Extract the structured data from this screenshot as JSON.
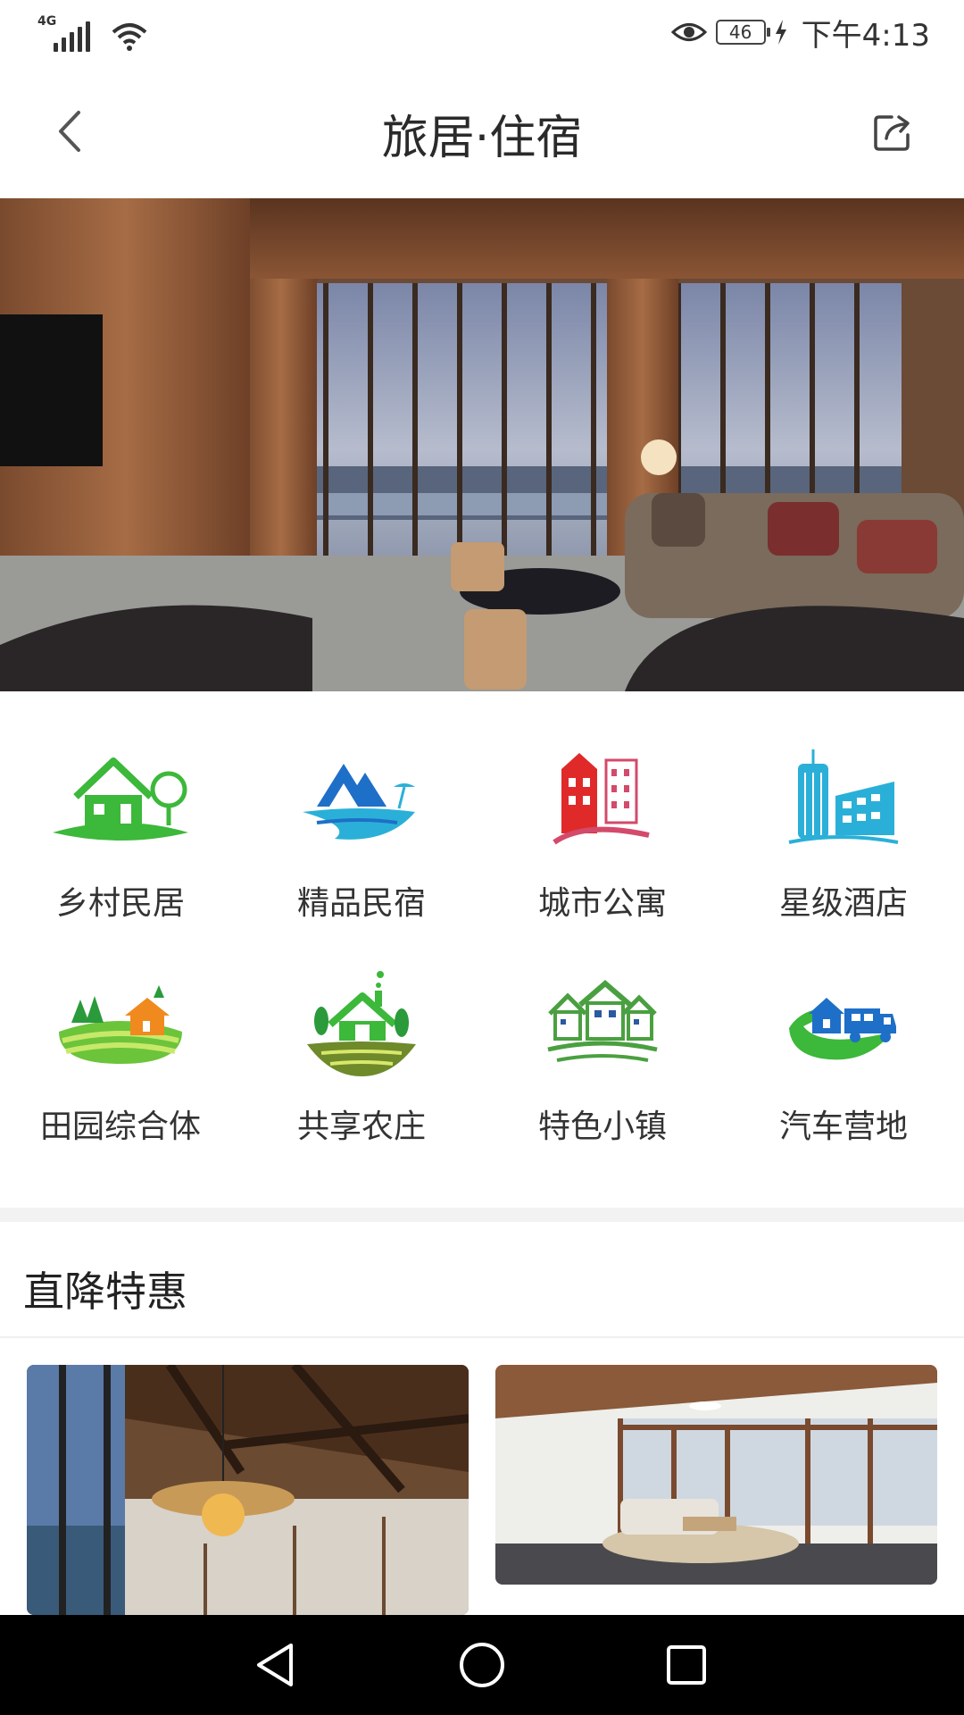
{
  "status_bar": {
    "network": "4G",
    "battery": "46",
    "time": "下午4:13",
    "icons": [
      "signal-icon",
      "wifi-icon",
      "eye-icon",
      "battery-icon",
      "charging-icon"
    ]
  },
  "header": {
    "title": "旅居·住宿",
    "back_icon": "chevron-left-icon",
    "share_icon": "share-icon"
  },
  "hero": {
    "image": "wood-lounge-lake-view-photo"
  },
  "categories": [
    {
      "label": "乡村民居",
      "icon": "village-house-icon",
      "color": "#3cb83a"
    },
    {
      "label": "精品民宿",
      "icon": "boutique-cabin-icon",
      "color": "#1e6fc8"
    },
    {
      "label": "城市公寓",
      "icon": "city-apartment-icon",
      "color": "#e02a2a"
    },
    {
      "label": "星级酒店",
      "icon": "star-hotel-icon",
      "color": "#2ab0d8"
    },
    {
      "label": "田园综合体",
      "icon": "farm-complex-icon",
      "color": "#6cc43a"
    },
    {
      "label": "共享农庄",
      "icon": "shared-farm-icon",
      "color": "#3cb83a"
    },
    {
      "label": "特色小镇",
      "icon": "featured-town-icon",
      "color": "#4aa040"
    },
    {
      "label": "汽车营地",
      "icon": "rv-camp-icon",
      "color": "#1e6fc8"
    }
  ],
  "section": {
    "title": "直降特惠"
  },
  "cards": [
    {
      "image": "wooden-loft-interior-photo"
    },
    {
      "image": "bright-living-room-photo"
    }
  ],
  "nav": {
    "back_icon": "triangle-back-icon",
    "home_icon": "circle-home-icon",
    "recent_icon": "square-recents-icon"
  }
}
